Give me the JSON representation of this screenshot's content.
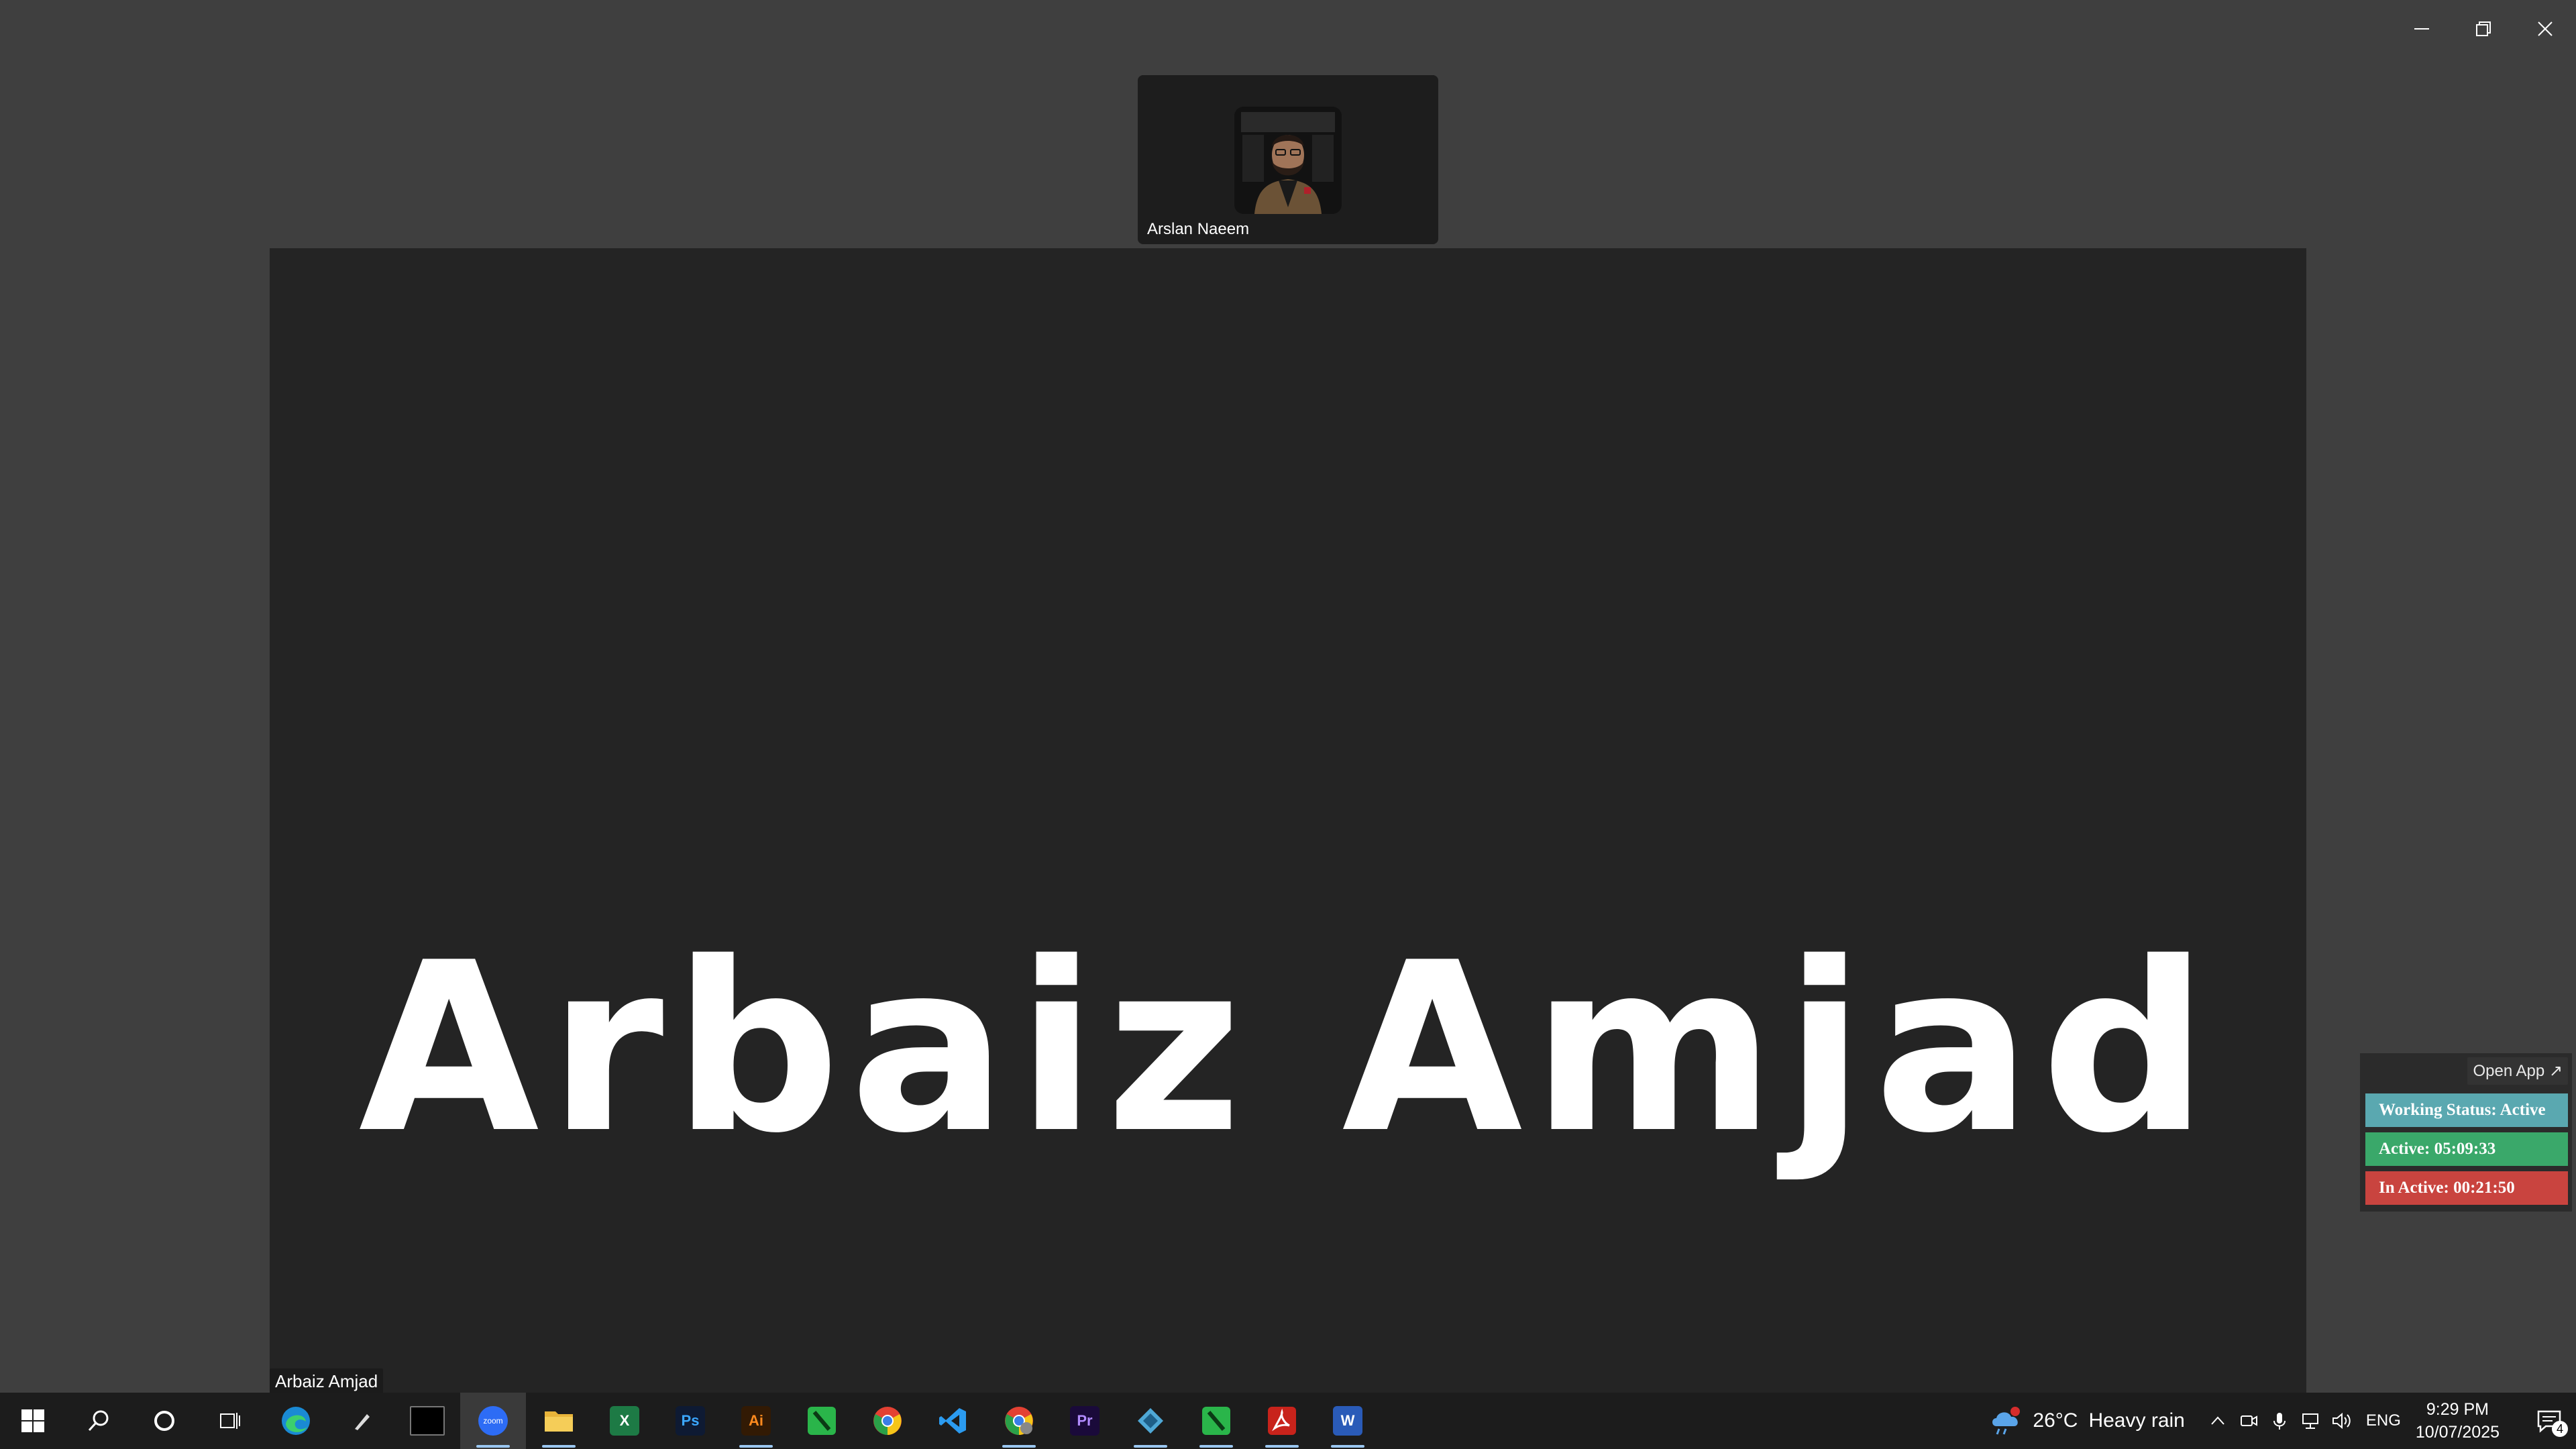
{
  "window": {
    "controls": [
      "minimize",
      "restore",
      "close"
    ]
  },
  "thumbnail": {
    "participant_name": "Arslan Naeem"
  },
  "main_tile": {
    "display_name": "Arbaiz Amjad",
    "speaker_label": "Arbaiz Amjad"
  },
  "tracker": {
    "open_app_label": "Open App ↗",
    "status_label": "Working Status: Active",
    "active_label": "Active: 05:09:33",
    "inactive_label": "In Active: 00:21:50",
    "colors": {
      "status": "#5aa8b0",
      "active": "#3aa86a",
      "inactive": "#c9443f"
    }
  },
  "taskbar": {
    "apps": [
      {
        "name": "edge",
        "label": ""
      },
      {
        "name": "pen-tool",
        "label": ""
      },
      {
        "name": "terminal",
        "label": ""
      },
      {
        "name": "zoom",
        "label": "zoom"
      },
      {
        "name": "file-explorer",
        "label": ""
      },
      {
        "name": "excel",
        "label": "X"
      },
      {
        "name": "photoshop",
        "label": "Ps"
      },
      {
        "name": "illustrator",
        "label": "Ai"
      },
      {
        "name": "green-app",
        "label": ""
      },
      {
        "name": "chrome",
        "label": ""
      },
      {
        "name": "vscode",
        "label": ""
      },
      {
        "name": "chrome-profile",
        "label": ""
      },
      {
        "name": "premiere",
        "label": "Pr"
      },
      {
        "name": "app-diamond",
        "label": ""
      },
      {
        "name": "green-app-2",
        "label": ""
      },
      {
        "name": "acrobat",
        "label": ""
      },
      {
        "name": "word",
        "label": "W"
      }
    ],
    "weather": {
      "temp": "26°C",
      "condition": "Heavy rain"
    },
    "language": "ENG",
    "time": "9:29 PM",
    "date": "10/07/2025",
    "notification_count": "4"
  }
}
